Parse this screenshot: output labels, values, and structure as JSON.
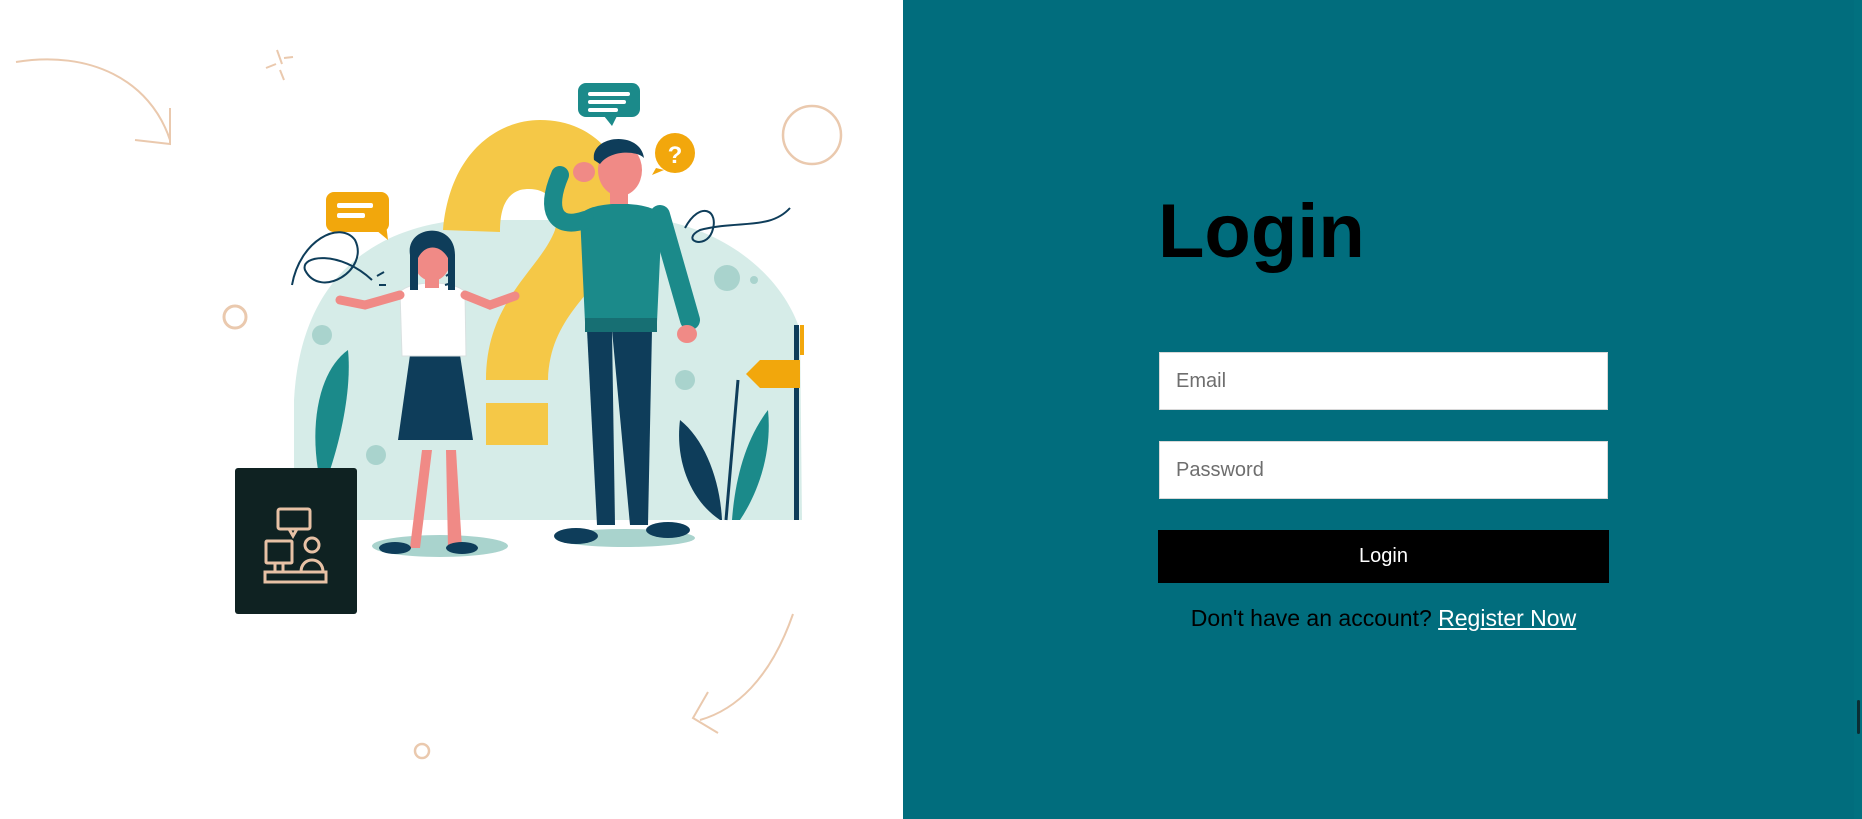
{
  "page": {
    "title": "Login",
    "colors": {
      "panel": "#016d7d",
      "button": "#000000",
      "link": "#ffffff"
    }
  },
  "form": {
    "email_placeholder": "Email",
    "password_placeholder": "Password",
    "submit_label": "Login"
  },
  "footer": {
    "prompt": "Don't have an account?",
    "register_link": "Register Now"
  },
  "illustration": {
    "icons": [
      "speech-bubble-icon",
      "question-bubble-icon",
      "desk-support-icon",
      "arrow-doodle-icon",
      "plant-icon"
    ]
  }
}
